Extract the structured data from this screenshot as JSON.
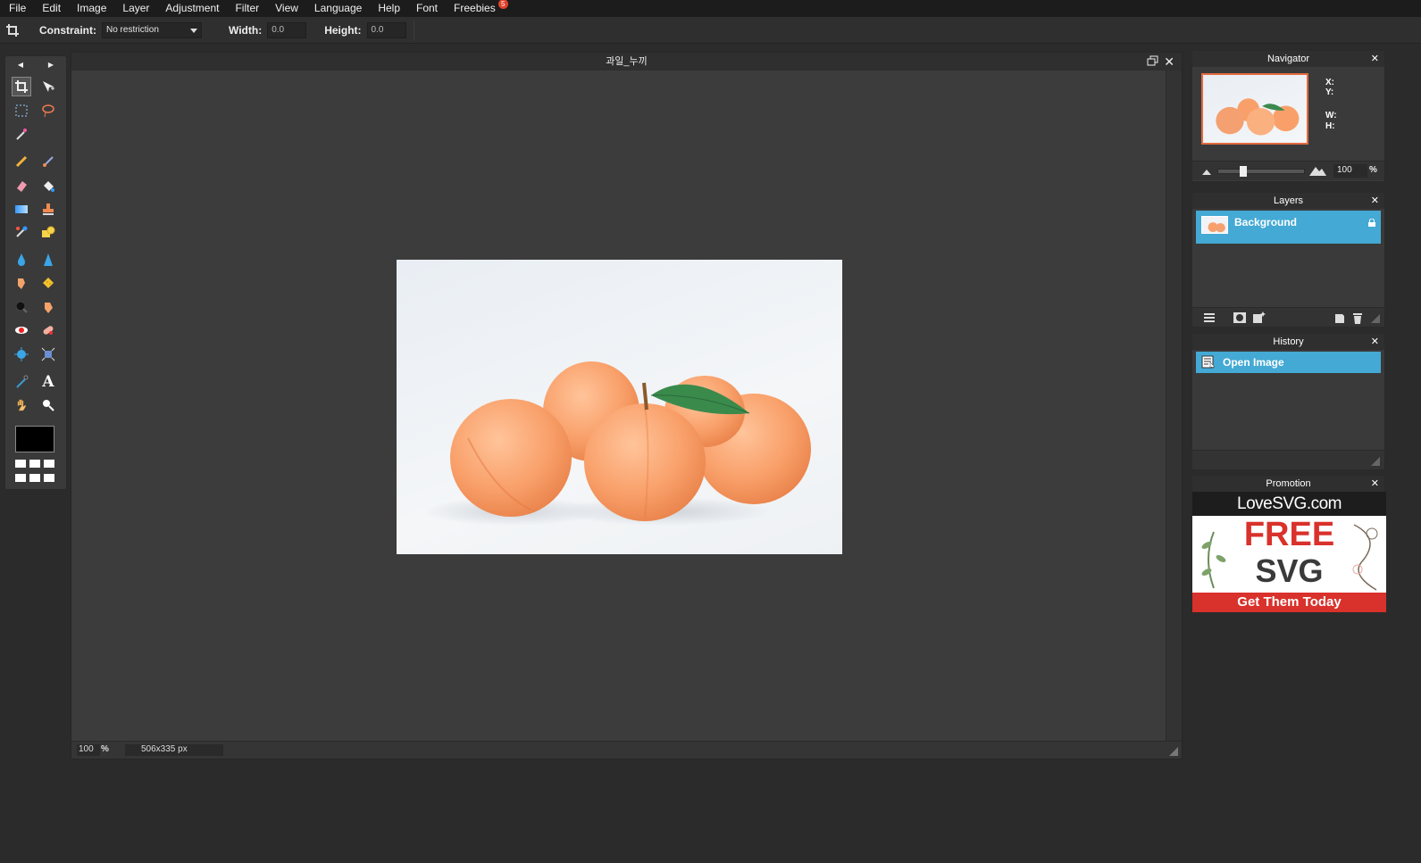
{
  "menubar": {
    "items": [
      "File",
      "Edit",
      "Image",
      "Layer",
      "Adjustment",
      "Filter",
      "View",
      "Language",
      "Help",
      "Font",
      "Freebies"
    ],
    "freebies_badge": "5"
  },
  "options": {
    "constraint_label": "Constraint:",
    "constraint_value": "No restriction",
    "width_label": "Width:",
    "width_value": "0.0",
    "height_label": "Height:",
    "height_value": "0.0"
  },
  "document": {
    "title": "과일_누끼",
    "zoom": "100",
    "zoom_unit": "%",
    "dimensions": "506x335 px"
  },
  "navigator": {
    "title": "Navigator",
    "x_label": "X:",
    "y_label": "Y:",
    "w_label": "W:",
    "h_label": "H:",
    "zoom": "100",
    "zoom_unit": "%"
  },
  "layers": {
    "title": "Layers",
    "items": [
      {
        "name": "Background",
        "locked": true
      }
    ]
  },
  "history": {
    "title": "History",
    "items": [
      {
        "label": "Open Image"
      }
    ]
  },
  "promotion": {
    "title": "Promotion",
    "brand": "LoveSVG.com",
    "line1": "FREE",
    "line2": "SVG",
    "cta": "Get Them Today"
  },
  "colors": {
    "accent": "#44a9d4",
    "promo_red": "#d9312b",
    "foreground": "#000000"
  },
  "tools": [
    "crop-icon",
    "move-icon",
    "marquee-icon",
    "lasso-icon",
    "magic-wand-icon",
    "pencil-icon",
    "brush-icon",
    "eraser-icon",
    "paint-bucket-icon",
    "gradient-icon",
    "clone-stamp-icon",
    "color-replace-icon",
    "drawing-shapes-icon",
    "blur-icon",
    "sharpen-icon",
    "smudge-icon",
    "sponge-icon",
    "dodge-icon",
    "burn-icon",
    "red-eye-icon",
    "spot-heal-icon",
    "bloat-icon",
    "pinch-icon",
    "color-picker-icon",
    "type-icon",
    "hand-icon",
    "zoom-icon"
  ]
}
